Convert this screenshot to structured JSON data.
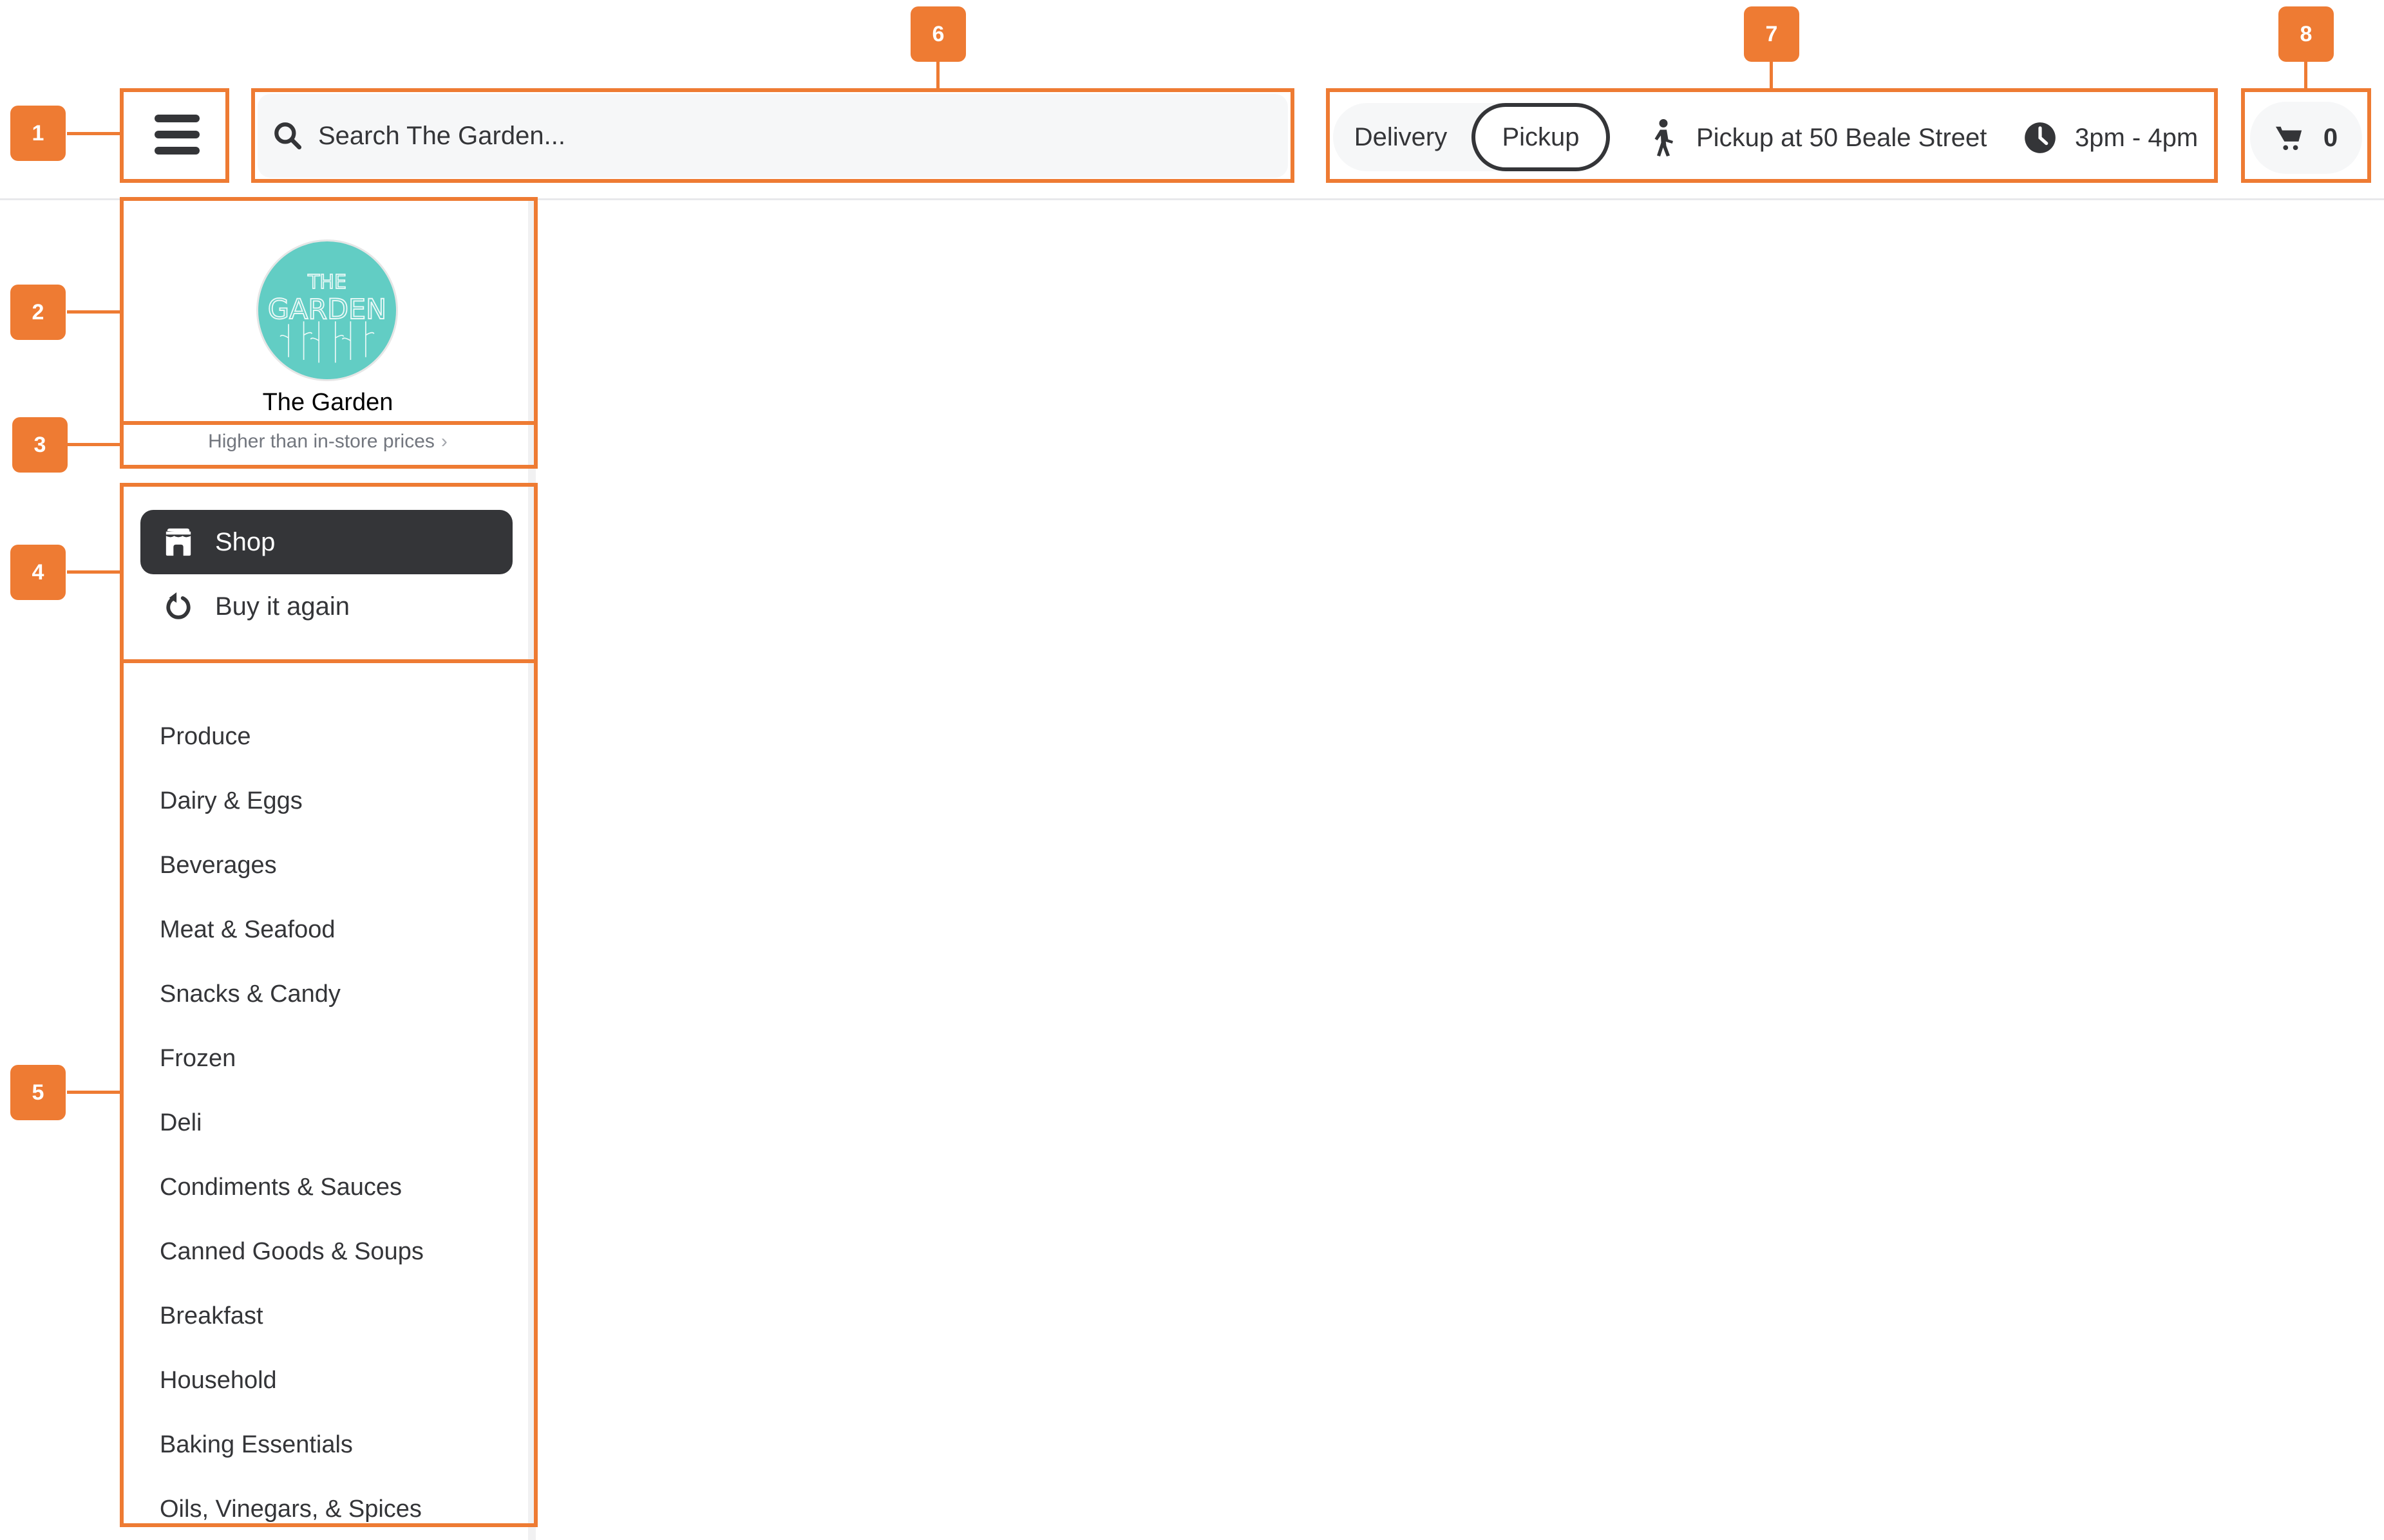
{
  "header": {
    "menu_icon": "hamburger-menu-icon",
    "search": {
      "icon": "search-icon",
      "placeholder": "Search The Garden...",
      "value": ""
    },
    "fulfillment": {
      "options": [
        "Delivery",
        "Pickup"
      ],
      "selected": "Pickup",
      "delivery_label": "Delivery",
      "pickup_label": "Pickup"
    },
    "pickup_location": {
      "icon": "walking-person-icon",
      "label": "Pickup at 50 Beale Street"
    },
    "time_slot": {
      "icon": "clock-icon",
      "label": "3pm - 4pm"
    },
    "cart": {
      "icon": "cart-icon",
      "count": "0"
    }
  },
  "store": {
    "name": "The Garden",
    "logo_text": [
      "THE",
      "GARDEN"
    ],
    "logo_color": "#62cdc4",
    "price_note": "Higher than in-store prices",
    "price_note_chevron": "›"
  },
  "nav": {
    "items": [
      {
        "label": "Shop",
        "icon": "storefront-icon",
        "active": true
      },
      {
        "label": "Buy it again",
        "icon": "reorder-icon",
        "active": false
      }
    ]
  },
  "categories": [
    "Produce",
    "Dairy & Eggs",
    "Beverages",
    "Meat & Seafood",
    "Snacks & Candy",
    "Frozen",
    "Deli",
    "Condiments & Sauces",
    "Canned Goods & Soups",
    "Breakfast",
    "Household",
    "Baking Essentials",
    "Oils, Vinegars, & Spices"
  ],
  "annotations": {
    "color": "#ee7b33",
    "labels": [
      "1",
      "2",
      "3",
      "4",
      "5",
      "6",
      "7",
      "8"
    ]
  }
}
